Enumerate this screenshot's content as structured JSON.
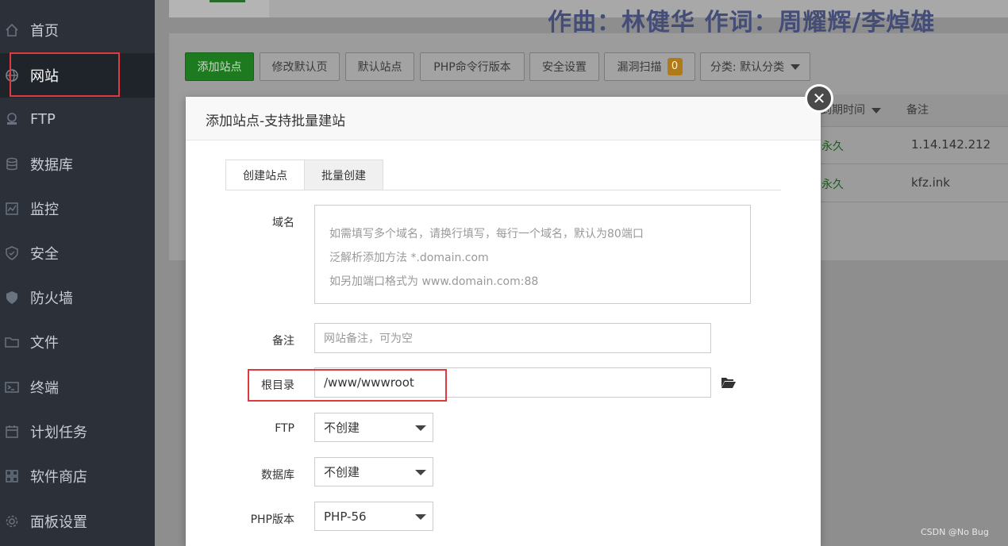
{
  "sidebar": {
    "items": [
      {
        "label": "首页",
        "icon": "home-icon"
      },
      {
        "label": "网站",
        "icon": "globe-icon"
      },
      {
        "label": "FTP",
        "icon": "ftp-icon"
      },
      {
        "label": "数据库",
        "icon": "database-icon"
      },
      {
        "label": "监控",
        "icon": "monitor-icon"
      },
      {
        "label": "安全",
        "icon": "shield-icon"
      },
      {
        "label": "防火墙",
        "icon": "firewall-icon"
      },
      {
        "label": "文件",
        "icon": "folder-icon"
      },
      {
        "label": "终端",
        "icon": "terminal-icon"
      },
      {
        "label": "计划任务",
        "icon": "calendar-icon"
      },
      {
        "label": "软件商店",
        "icon": "grid-icon"
      },
      {
        "label": "面板设置",
        "icon": "gear-icon"
      }
    ],
    "active_index": 1
  },
  "overlay_text": "作曲：林健华 作词：周耀辉/李焯雄",
  "toolbar": {
    "add_site": "添加站点",
    "edit_default_page": "修改默认页",
    "default_site": "默认站点",
    "php_cli_version": "PHP命令行版本",
    "security_settings": "安全设置",
    "vuln_scan": "漏洞扫描",
    "vuln_count": "0",
    "category": "分类: 默认分类"
  },
  "table": {
    "headers": {
      "expire": "到期时间",
      "note": "备注"
    },
    "rows": [
      {
        "expire": "永久",
        "note": "1.14.142.212"
      },
      {
        "expire": "永久",
        "note": "kfz.ink"
      }
    ]
  },
  "modal": {
    "title": "添加站点-支持批量建站",
    "tabs": [
      "创建站点",
      "批量创建"
    ],
    "domain_label": "域名",
    "domain_placeholder_lines": [
      "如需填写多个域名，请换行填写，每行一个域名，默认为80端口",
      "泛解析添加方法 *.domain.com",
      "如另加端口格式为 www.domain.com:88"
    ],
    "note_label": "备注",
    "note_placeholder": "网站备注，可为空",
    "root_label": "根目录",
    "root_value": "/www/wwwroot",
    "ftp_label": "FTP",
    "ftp_value": "不创建",
    "db_label": "数据库",
    "db_value": "不创建",
    "php_label": "PHP版本",
    "php_value": "PHP-56"
  },
  "watermark": "CSDN @No  Bug",
  "colors": {
    "accent_green": "#20a53a",
    "highlight_red": "#e0393e",
    "sidebar_bg": "#2b3039"
  }
}
